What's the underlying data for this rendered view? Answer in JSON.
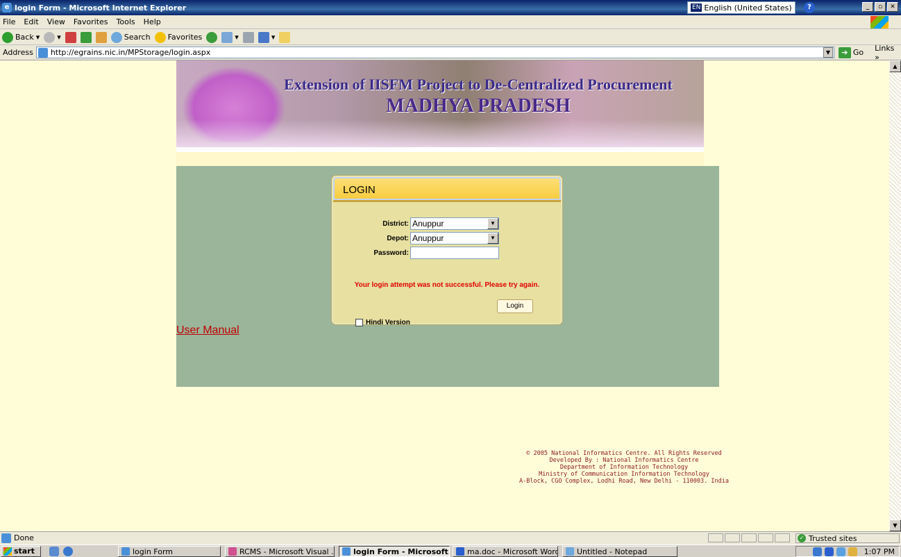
{
  "window": {
    "title": "login Form - Microsoft Internet Explorer",
    "language": "English (United States)",
    "language_code": "EN"
  },
  "menu": [
    "File",
    "Edit",
    "View",
    "Favorites",
    "Tools",
    "Help"
  ],
  "toolbar": {
    "back": "Back",
    "search": "Search",
    "favorites": "Favorites"
  },
  "address": {
    "label": "Address",
    "url": "http://egrains.nic.in/MPStorage/login.aspx",
    "go": "Go",
    "links": "Links"
  },
  "banner": {
    "line1": "Extension of IISFM Project to De-Centralized Procurement",
    "line2": "MADHYA PRADESH"
  },
  "login": {
    "title": "LOGIN",
    "district_label": "District:",
    "district_value": "Anuppur",
    "depot_label": "Depot:",
    "depot_value": "Anuppur",
    "password_label": "Password:",
    "password_value": "",
    "error": "Your login attempt was not successful. Please try again.",
    "button": "Login",
    "hindi_label": "Hindi Version",
    "hindi_checked": false
  },
  "user_manual": "User Manual",
  "footer": [
    "© 2005 National Informatics Centre. All Rights Reserved",
    "Developed By : National Informatics Centre",
    "Department of Information Technology",
    "Ministry of Communication Information Technology",
    "A-Block, CGO Complex, Lodhi Road, New Delhi - 110003. India"
  ],
  "status": {
    "text": "Done",
    "zone": "Trusted sites"
  },
  "taskbar": {
    "start": "start",
    "tasks": [
      "login Form",
      "RCMS - Microsoft Visual ...",
      "login Form - Microsoft...",
      "ma.doc - Microsoft Word",
      "Untitled - Notepad"
    ],
    "clock": "1:07 PM"
  },
  "colors": {
    "page_background": "#fffcd8",
    "main_area": "#9ab59a",
    "login_panel": "#e7e0a1",
    "login_header": "#f6cb3c",
    "error_text": "#e00000",
    "link": "#c00000"
  }
}
